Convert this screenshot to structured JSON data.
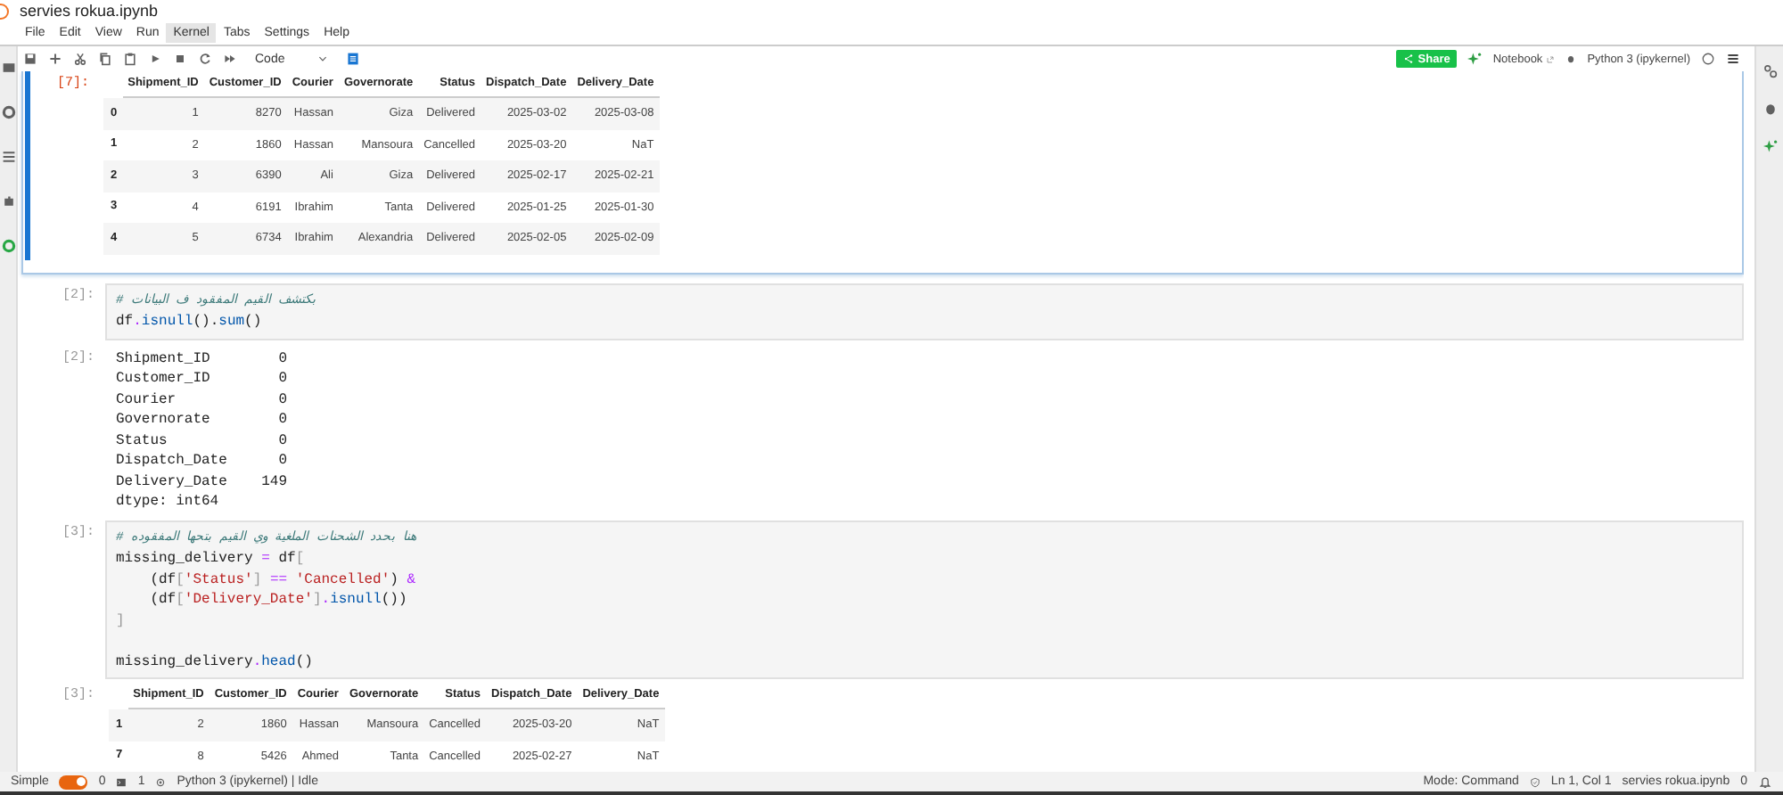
{
  "title": "servies rokua.ipynb",
  "menu": [
    {
      "label": "File",
      "selected": false
    },
    {
      "label": "Edit",
      "selected": false
    },
    {
      "label": "View",
      "selected": false
    },
    {
      "label": "Run",
      "selected": false
    },
    {
      "label": "Kernel",
      "selected": true
    },
    {
      "label": "Tabs",
      "selected": false
    },
    {
      "label": "Settings",
      "selected": false
    },
    {
      "label": "Help",
      "selected": false
    }
  ],
  "toolbar": {
    "cell_type": "Code",
    "share": "Share",
    "notebook": "Notebook",
    "kernel": "Python 3 (ipykernel)"
  },
  "cells": [
    {
      "kind": "table",
      "prompt": "[7]:",
      "selected": true,
      "columns": [
        "Shipment_ID",
        "Customer_ID",
        "Courier",
        "Governorate",
        "Status",
        "Dispatch_Date",
        "Delivery_Date"
      ],
      "rows": [
        {
          "index": "0",
          "values": [
            "1",
            "8270",
            "Hassan",
            "Giza",
            "Delivered",
            "2025-03-02",
            "2025-03-08"
          ]
        },
        {
          "index": "1",
          "values": [
            "2",
            "1860",
            "Hassan",
            "Mansoura",
            "Cancelled",
            "2025-03-20",
            "NaT"
          ]
        },
        {
          "index": "2",
          "values": [
            "3",
            "6390",
            "Ali",
            "Giza",
            "Delivered",
            "2025-02-17",
            "2025-02-21"
          ]
        },
        {
          "index": "3",
          "values": [
            "4",
            "6191",
            "Ibrahim",
            "Tanta",
            "Delivered",
            "2025-01-25",
            "2025-01-30"
          ]
        },
        {
          "index": "4",
          "values": [
            "5",
            "6734",
            "Ibrahim",
            "Alexandria",
            "Delivered",
            "2025-02-05",
            "2025-02-09"
          ]
        }
      ]
    },
    {
      "kind": "code",
      "prompt": "[2]:",
      "lines": [
        {
          "kind": "code",
          "tokens": [
            {
              "text": "# بكتشف القيم المفقود ف البيانات",
              "kind": "comment"
            }
          ]
        },
        {
          "kind": "code",
          "tokens": [
            {
              "text": "df",
              "kind": "var"
            },
            {
              "text": ".",
              "kind": "op"
            },
            {
              "text": "isnull",
              "kind": "prop"
            },
            {
              "text": "().",
              "kind": "var"
            },
            {
              "text": "sum",
              "kind": "prop"
            },
            {
              "text": "()",
              "kind": "var"
            }
          ]
        }
      ]
    },
    {
      "kind": "text",
      "prompt": "[2]:",
      "lines": [
        "Shipment_ID        0",
        "Customer_ID        0",
        "Courier            0",
        "Governorate        0",
        "Status             0",
        "Dispatch_Date      0",
        "Delivery_Date    149",
        "dtype: int64"
      ]
    },
    {
      "kind": "code",
      "prompt": "[3]:",
      "lines": [
        {
          "kind": "code",
          "tokens": [
            {
              "text": "# هنا بحدد الشحنات الملغية وي القيم بتحها المفقوده",
              "kind": "comment"
            }
          ]
        },
        {
          "kind": "code",
          "tokens": [
            {
              "text": "missing_delivery ",
              "kind": "var"
            },
            {
              "text": "=",
              "kind": "op"
            },
            {
              "text": " df",
              "kind": "var"
            },
            {
              "text": "[",
              "kind": "bracket"
            }
          ]
        },
        {
          "kind": "code",
          "tokens": [
            {
              "text": "    (df",
              "kind": "var"
            },
            {
              "text": "[",
              "kind": "bracket"
            },
            {
              "text": "'Status'",
              "kind": "str"
            },
            {
              "text": "] ",
              "kind": "bracket"
            },
            {
              "text": "== ",
              "kind": "op"
            },
            {
              "text": "'Cancelled'",
              "kind": "str"
            },
            {
              "text": ") ",
              "kind": "var"
            },
            {
              "text": "&",
              "kind": "op"
            }
          ]
        },
        {
          "kind": "code",
          "tokens": [
            {
              "text": "    (df",
              "kind": "var"
            },
            {
              "text": "[",
              "kind": "bracket"
            },
            {
              "text": "'Delivery_Date'",
              "kind": "str"
            },
            {
              "text": "]",
              "kind": "bracket"
            },
            {
              "text": ".",
              "kind": "op"
            },
            {
              "text": "isnull",
              "kind": "prop"
            },
            {
              "text": "())",
              "kind": "var"
            }
          ]
        },
        {
          "kind": "code",
          "tokens": [
            {
              "text": "]",
              "kind": "bracket"
            }
          ]
        },
        {
          "kind": "blank"
        },
        {
          "kind": "code",
          "tokens": [
            {
              "text": "missing_delivery",
              "kind": "var"
            },
            {
              "text": ".",
              "kind": "op"
            },
            {
              "text": "head",
              "kind": "prop"
            },
            {
              "text": "()",
              "kind": "var"
            }
          ]
        }
      ]
    },
    {
      "kind": "table",
      "prompt": "[3]:",
      "selected": false,
      "columns": [
        "Shipment_ID",
        "Customer_ID",
        "Courier",
        "Governorate",
        "Status",
        "Dispatch_Date",
        "Delivery_Date"
      ],
      "rows": [
        {
          "index": "1",
          "values": [
            "2",
            "1860",
            "Hassan",
            "Mansoura",
            "Cancelled",
            "2025-03-20",
            "NaT"
          ]
        },
        {
          "index": "7",
          "values": [
            "8",
            "5426",
            "Ahmed",
            "Tanta",
            "Cancelled",
            "2025-02-27",
            "NaT"
          ]
        }
      ]
    }
  ],
  "status": {
    "mode": "Simple",
    "simple_on": true,
    "terminals": "0",
    "kernels": "1",
    "kernel_status": "Python 3 (ipykernel) | Idle",
    "mode_text": "Mode: Command",
    "position": "Ln 1, Col 1",
    "file": "servies rokua.ipynb",
    "notifications": "0"
  }
}
